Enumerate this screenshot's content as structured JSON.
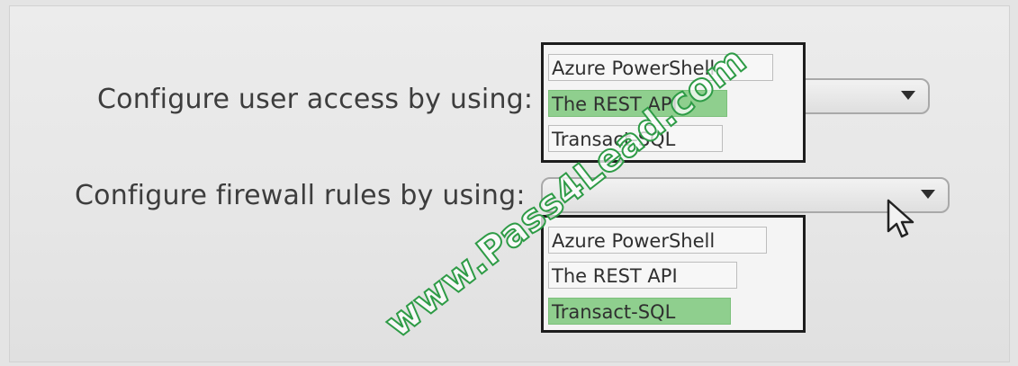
{
  "rows": [
    {
      "label": "Configure user access by using:",
      "options": [
        "Azure PowerShell",
        "The REST API",
        "Transact-SQL"
      ],
      "selected_index": 1
    },
    {
      "label": "Configure firewall rules by using:",
      "options": [
        "Azure PowerShell",
        "The REST API",
        "Transact-SQL"
      ],
      "selected_index": 2
    }
  ],
  "watermark": "www.Pass4Lead.com",
  "colors": {
    "selection": "#8fcf8e",
    "watermark_stroke": "#2e9b46"
  },
  "icons": {
    "dropdown": "chevron-down-icon",
    "cursor": "mouse-pointer-icon"
  }
}
